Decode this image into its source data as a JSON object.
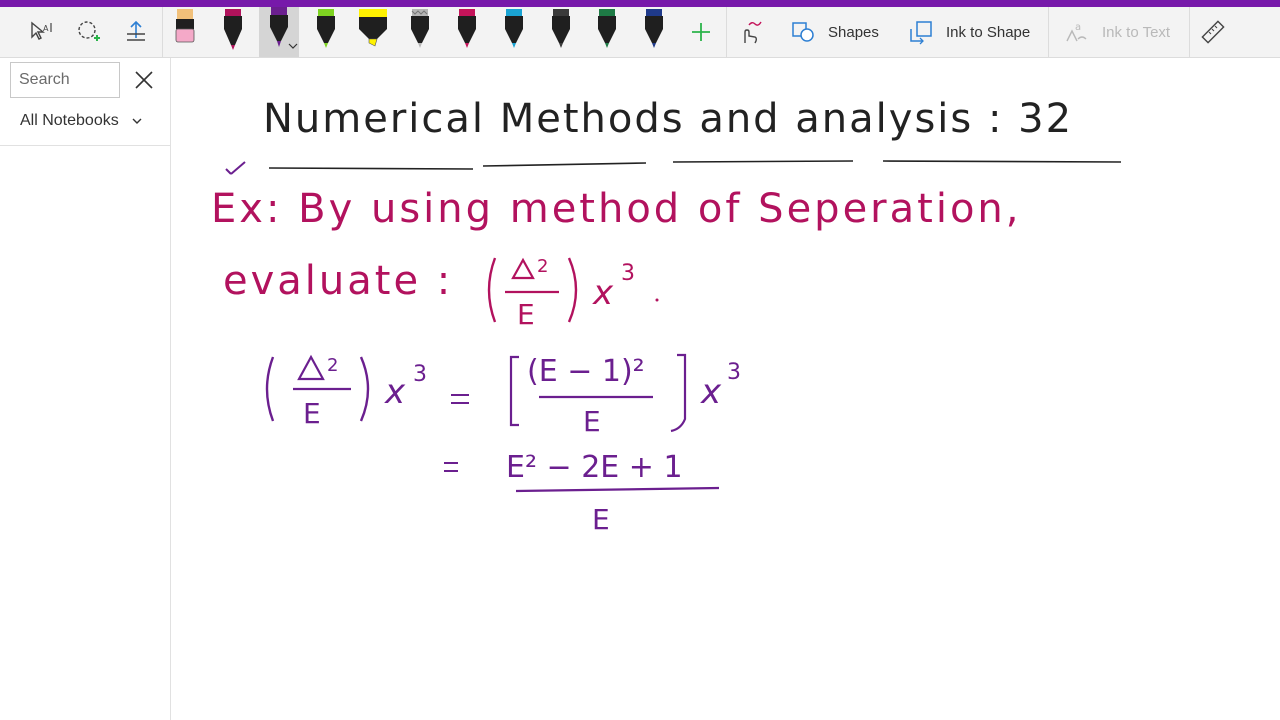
{
  "colors": {
    "brand": "#7719aa",
    "toolbar_bg": "#f3f3f3",
    "add_pen": "#2bb34a",
    "ink_black": "#222222",
    "ink_magenta": "#b2125e",
    "ink_purple": "#6b1f8f"
  },
  "toolbar": {
    "icons": [
      "lasso-select-icon",
      "lasso-add-icon",
      "add-space-icon",
      "ink-replay-icon",
      "ruler-icon"
    ],
    "pens": [
      {
        "name": "highlighter-peach-pen",
        "color": "#f4a9c8"
      },
      {
        "name": "magenta-pen",
        "color": "#b0125b"
      },
      {
        "name": "purple-pen",
        "color": "#6b1f8f",
        "selected": true
      },
      {
        "name": "green-pen",
        "color": "#7ed321"
      },
      {
        "name": "yellow-highlighter",
        "color": "#fff200"
      },
      {
        "name": "silver-pen",
        "color": "#b5b5b5"
      },
      {
        "name": "red-pen",
        "color": "#c4145a"
      },
      {
        "name": "teal-pen",
        "color": "#1aa3d3"
      },
      {
        "name": "dark-gray-pen",
        "color": "#3a3a3a"
      },
      {
        "name": "dark-green-pen",
        "color": "#1e7a45"
      },
      {
        "name": "navy-pen",
        "color": "#1f3a8a"
      }
    ],
    "shapes_label": "Shapes",
    "ink_to_shape_label": "Ink to Shape",
    "ink_to_text_label": "Ink to Text"
  },
  "sidebar": {
    "search_placeholder": "Search",
    "notebook_filter": "All Notebooks"
  },
  "page": {
    "title": "Numerical Methods and analysis : 32",
    "example_line1": "Ex: By using method of Seperation,",
    "example_line2_prefix": "evaluate :",
    "eq1_rhs_numerator": "(E − 1)²",
    "eq2_numerator": "E² − 2E + 1"
  }
}
